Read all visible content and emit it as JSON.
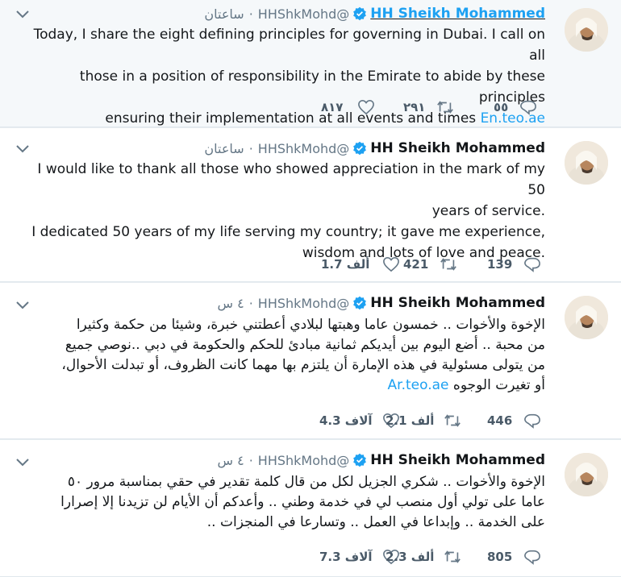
{
  "tweets": [
    {
      "name": "HH Sheikh Mohammed",
      "handle": "@HHShkMohd",
      "time": "ساعتان",
      "text_lines": [
        "Today, I share the eight defining principles for governing in Dubai. I call on all",
        "those in a position of responsibility in the Emirate to abide by these principles",
        "ensuring their implementation at all events and times"
      ],
      "link": "En.teo.ae",
      "replies": "٥٥",
      "retweets": "٢٩١",
      "likes": "٨١٧"
    },
    {
      "name": "HH Sheikh Mohammed",
      "handle": "@HHShkMohd",
      "time": "ساعتان",
      "text_lines": [
        "I would like to thank all those who showed appreciation in the mark of my 50",
        "years of service.",
        "I dedicated 50 years of my life serving my country; it gave me experience,",
        "wisdom and lots of love and peace."
      ],
      "replies": "139",
      "retweets": "421",
      "likes": "1.7 ألف"
    },
    {
      "name": "HH Sheikh Mohammed",
      "handle": "@HHShkMohd",
      "time": "٤ س",
      "text_lines": [
        "الإخوة والأخوات .. خمسون عاما وهبتها لبلادي أعطتني خبرة، وشيئا من حكمة وكثيرا",
        "من محبة .. أضع اليوم بين أيديكم ثمانية مبادئ للحكم والحكومة في دبي ..نوصي جميع",
        "من يتولى مسئولية في هذه الإمارة أن يلتزم بها مهما كانت الظروف، أو تبدلت الأحوال،",
        "أو تغيرت الوجوه"
      ],
      "link": "Ar.teo.ae",
      "replies": "446",
      "retweets": "2.1 ألف",
      "likes": "4.3 آلاف"
    },
    {
      "name": "HH Sheikh Mohammed",
      "handle": "@HHShkMohd",
      "time": "٤ س",
      "text_lines": [
        "الإخوة والأخوات .. شكري الجزيل لكل من قال كلمة تقدير في حقي بمناسبة مرور ٥٠",
        "عاما على تولي أول منصب لي في خدمة وطني .. وأعدكم أن الأيام لن تزيدنا إلا إصرارا",
        "على الخدمة .. وإبداعا في العمل .. وتسارعا في المنجزات .."
      ],
      "replies": "805",
      "retweets": "2.3 ألف",
      "likes": "7.3 آلاف"
    }
  ],
  "colors": {
    "accent": "#1da1f2",
    "muted": "#657786",
    "border": "#e1e8ed"
  }
}
